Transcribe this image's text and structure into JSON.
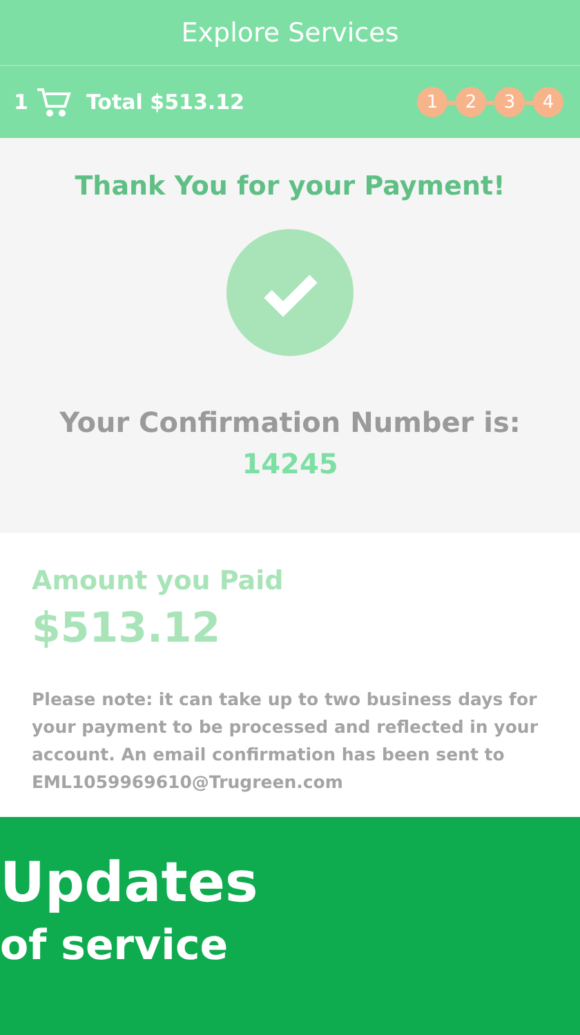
{
  "header": {
    "title": "Explore Services"
  },
  "cart_bar": {
    "count": "1",
    "total": "Total $513.12",
    "steps": [
      "1",
      "2",
      "3",
      "4"
    ]
  },
  "confirmation": {
    "heading": "Thank You for your Payment!",
    "label": "Your Confirmation Number is:",
    "number": "14245"
  },
  "amount": {
    "label": "Amount you Paid",
    "value": "$513.12",
    "note": "Please note: it can take up to two business days for your payment to be processed and reflected in your account. An email confirmation has been sent to EML1059969610@Trugreen.com"
  },
  "banner": {
    "title": "Updates",
    "subtitle": "of service"
  }
}
